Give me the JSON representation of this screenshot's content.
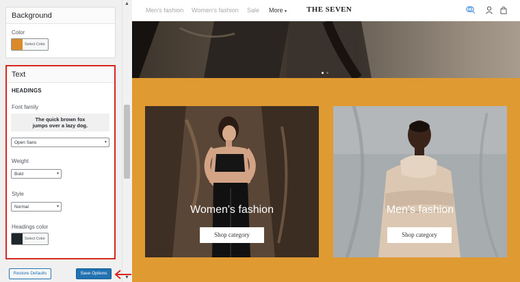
{
  "panel": {
    "background_section": {
      "title": "Background",
      "color_label": "Color",
      "picker_label": "Select Color",
      "swatch_color": "#d98a2b"
    },
    "text_section": {
      "title": "Text",
      "headings_label": "HEADINGS",
      "font_family_label": "Font family",
      "preview_line1": "The quick brown fox",
      "preview_line2": "jumps over a lazy dog.",
      "font_family_value": "Open Sans",
      "weight_label": "Weight",
      "weight_value": "Bold",
      "style_label": "Style",
      "style_value": "Normal",
      "headings_color_label": "Headings color",
      "picker_label": "Select Color",
      "swatch_color": "#1f262c"
    },
    "restore_button": "Restore Defaults",
    "save_button": "Save Options",
    "highlight_color": "#d7261e"
  },
  "site": {
    "nav": [
      "Men's fashion",
      "Women's fashion",
      "Sale"
    ],
    "nav_more": "More",
    "brand": "THE SEVEN",
    "accent_color": "#e09a32",
    "cards": [
      {
        "title": "Women's fashion",
        "button": "Shop category"
      },
      {
        "title": "Men's fashion",
        "button": "Shop category"
      }
    ]
  }
}
